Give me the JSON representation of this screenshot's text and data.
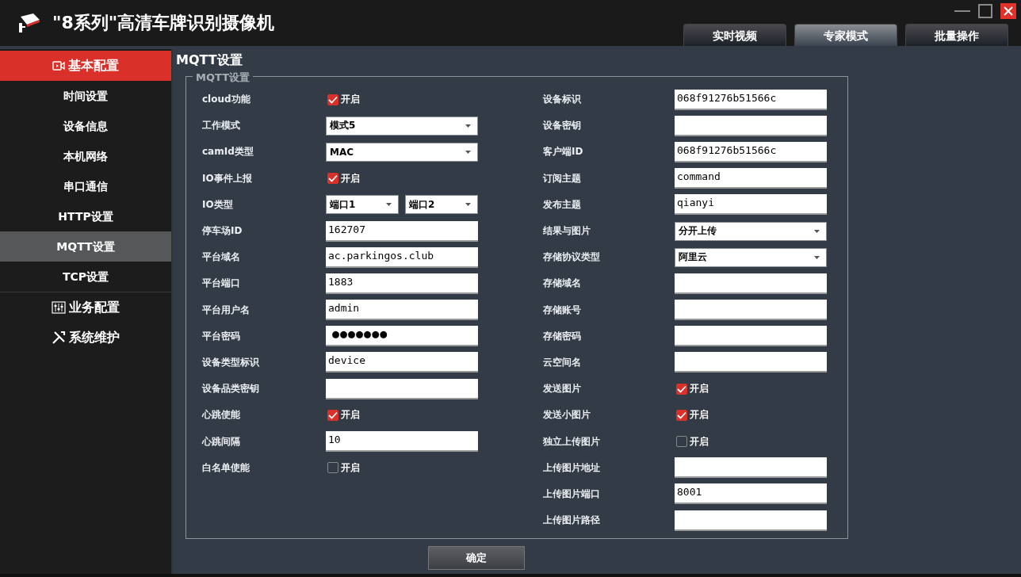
{
  "window": {
    "title": "\"8系列\"高清车牌识别摄像机"
  },
  "tabs": [
    {
      "label": "实时视频",
      "selected": false
    },
    {
      "label": "专家模式",
      "selected": true
    },
    {
      "label": "批量操作",
      "selected": false
    }
  ],
  "sidebar": {
    "sections": [
      {
        "label": "基本配置",
        "kind": "video",
        "expanded": true,
        "items": [
          {
            "label": "时间设置",
            "selected": false
          },
          {
            "label": "设备信息",
            "selected": false
          },
          {
            "label": "本机网络",
            "selected": false
          },
          {
            "label": "串口通信",
            "selected": false
          },
          {
            "label": "HTTP设置",
            "selected": false
          },
          {
            "label": "MQTT设置",
            "selected": true
          },
          {
            "label": "TCP设置",
            "selected": false
          }
        ]
      },
      {
        "label": "业务配置",
        "kind": "sliders",
        "expanded": false
      },
      {
        "label": "系统维护",
        "kind": "tools",
        "expanded": false
      }
    ]
  },
  "page_title": "MQTT设置",
  "group": {
    "title": "MQTT设置",
    "left_fields": [
      {
        "label": "cloud功能",
        "kind": "checkbox",
        "checked": true,
        "text": "开启"
      },
      {
        "label": "工作模式",
        "kind": "select",
        "value": "模式5"
      },
      {
        "label": "camId类型",
        "kind": "select",
        "value": "MAC"
      },
      {
        "label": "IO事件上报",
        "kind": "checkbox",
        "checked": true,
        "text": "开启"
      },
      {
        "label": "IO类型",
        "kind": "select2",
        "values": [
          "端口1",
          "端口2"
        ]
      },
      {
        "label": "停车场ID",
        "kind": "text",
        "value": "162707"
      },
      {
        "label": "平台域名",
        "kind": "text",
        "value": "ac.parkingos.club"
      },
      {
        "label": "平台端口",
        "kind": "text",
        "value": "1883"
      },
      {
        "label": "平台用户名",
        "kind": "text",
        "value": "admin"
      },
      {
        "label": "平台密码",
        "kind": "password",
        "value": "●●●●●●●"
      },
      {
        "label": "设备类型标识",
        "kind": "text",
        "value": "device"
      },
      {
        "label": "设备品类密钥",
        "kind": "text"
      },
      {
        "label": "心跳使能",
        "kind": "checkbox",
        "checked": true,
        "text": "开启"
      },
      {
        "label": "心跳间隔",
        "kind": "text",
        "value": "10"
      },
      {
        "label": "白名单使能",
        "kind": "checkbox",
        "checked": false,
        "text": "开启"
      }
    ],
    "right_fields": [
      {
        "label": "设备标识",
        "kind": "text",
        "value": "068f91276b51566c"
      },
      {
        "label": "设备密钥",
        "kind": "text"
      },
      {
        "label": "客户端ID",
        "kind": "text",
        "value": "068f91276b51566c"
      },
      {
        "label": "订阅主题",
        "kind": "text",
        "value": "command"
      },
      {
        "label": "发布主题",
        "kind": "text",
        "value": "qianyi"
      },
      {
        "label": "结果与图片",
        "kind": "select",
        "value": "分开上传"
      },
      {
        "label": "存储协议类型",
        "kind": "select",
        "value": "阿里云"
      },
      {
        "label": "存储域名",
        "kind": "text"
      },
      {
        "label": "存储账号",
        "kind": "text"
      },
      {
        "label": "存储密码",
        "kind": "text"
      },
      {
        "label": "云空间名",
        "kind": "text"
      },
      {
        "label": "发送图片",
        "kind": "checkbox",
        "checked": true,
        "text": "开启"
      },
      {
        "label": "发送小图片",
        "kind": "checkbox",
        "checked": true,
        "text": "开启"
      },
      {
        "label": "独立上传图片",
        "kind": "checkbox",
        "checked": false,
        "text": "开启"
      },
      {
        "label": "上传图片地址",
        "kind": "text"
      },
      {
        "label": "上传图片端口",
        "kind": "text",
        "value": "8001"
      },
      {
        "label": "上传图片路径",
        "kind": "text"
      }
    ]
  },
  "buttons": [
    {
      "label": "确定"
    }
  ]
}
